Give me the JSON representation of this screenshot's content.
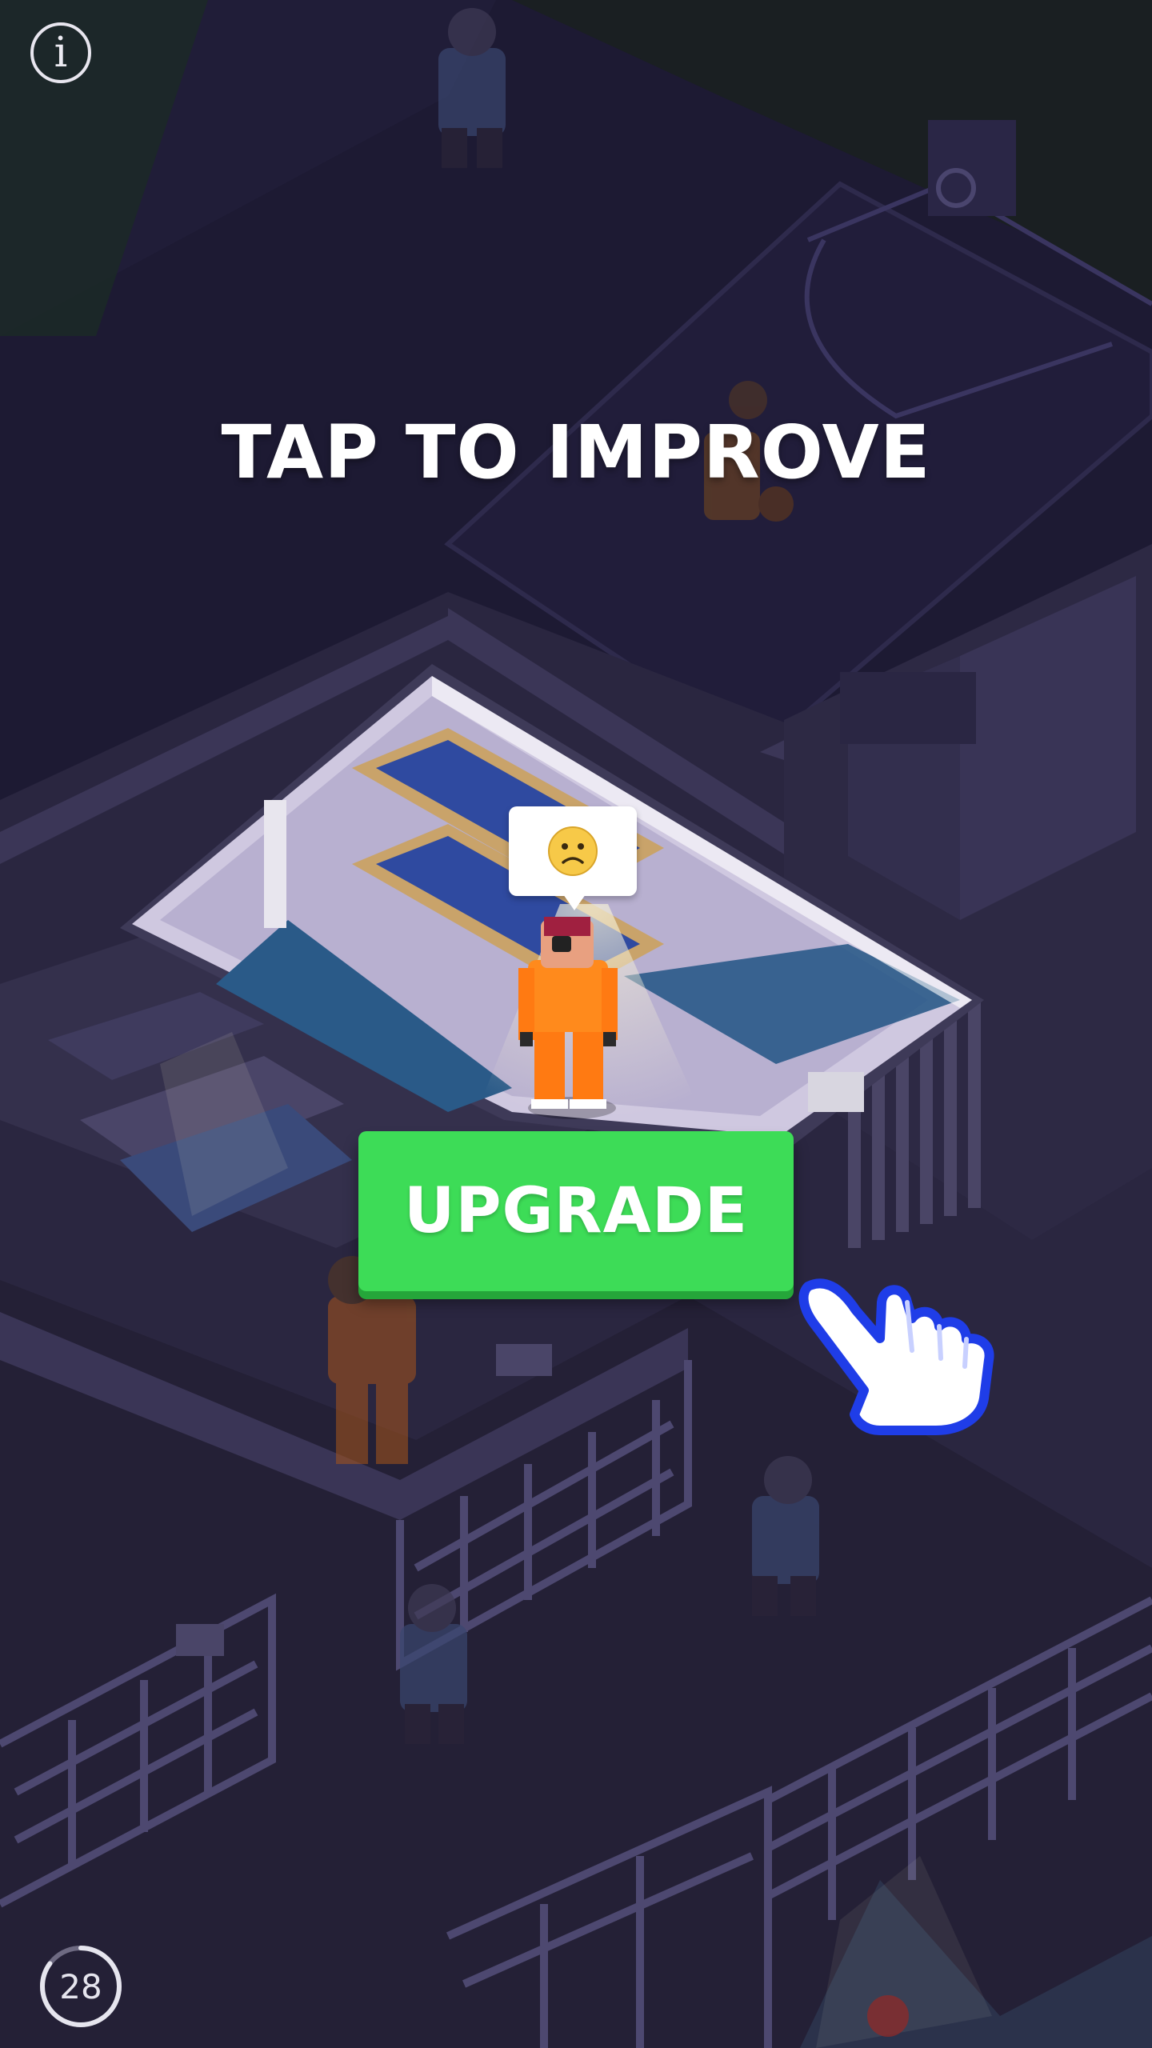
{
  "headline": "TAP TO IMPROVE",
  "upgrade_button": {
    "label": "UPGRADE"
  },
  "info_button": {
    "glyph": "i"
  },
  "timer": {
    "value": "28",
    "progress": 0.85
  },
  "prisoner": {
    "mood": "sad",
    "mood_icon": "sad-face-emoji"
  },
  "colors": {
    "background": "#1d1a33",
    "cell_floor": "#d7cfe6",
    "cell_wall": "#7a7090",
    "prisoner_suit": "#ff7a12",
    "button_green": "#3ddc57",
    "button_shadow": "#25a63a",
    "hand_outline": "#1f3de8"
  }
}
